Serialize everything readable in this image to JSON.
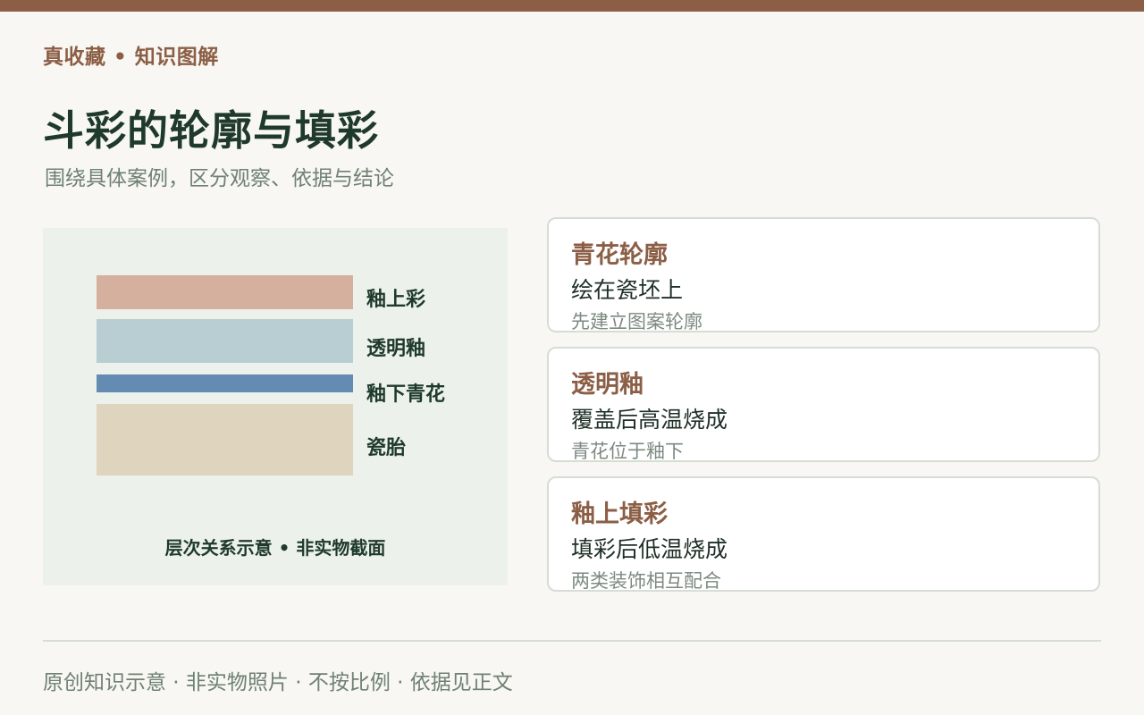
{
  "brand": "真收藏 • 知识图解",
  "title": "斗彩的轮廓与填彩",
  "subtitle": "围绕具体案例，区分观察、依据与结论",
  "diagram": {
    "layers": [
      {
        "label": "釉上彩",
        "color": "#d6b09e"
      },
      {
        "label": "透明釉",
        "color": "#b8ced2"
      },
      {
        "label": "釉下青花",
        "color": "#648cb2"
      },
      {
        "label": "瓷胎",
        "color": "#dfd4bd"
      }
    ],
    "caption": "层次关系示意 • 非实物截面"
  },
  "cards": [
    {
      "title": "青花轮廓",
      "main": "绘在瓷坯上",
      "note": "先建立图案轮廓"
    },
    {
      "title": "透明釉",
      "main": "覆盖后高温烧成",
      "note": "青花位于釉下"
    },
    {
      "title": "釉上填彩",
      "main": "填彩后低温烧成",
      "note": "两类装饰相互配合"
    }
  ],
  "footer": "原创知识示意 · 非实物照片 · 不按比例 · 依据见正文",
  "colors": {
    "accent": "#8b5e45",
    "heading": "#1f3a2c",
    "muted": "#6f8173",
    "panel_bg": "#ecf1ec"
  }
}
